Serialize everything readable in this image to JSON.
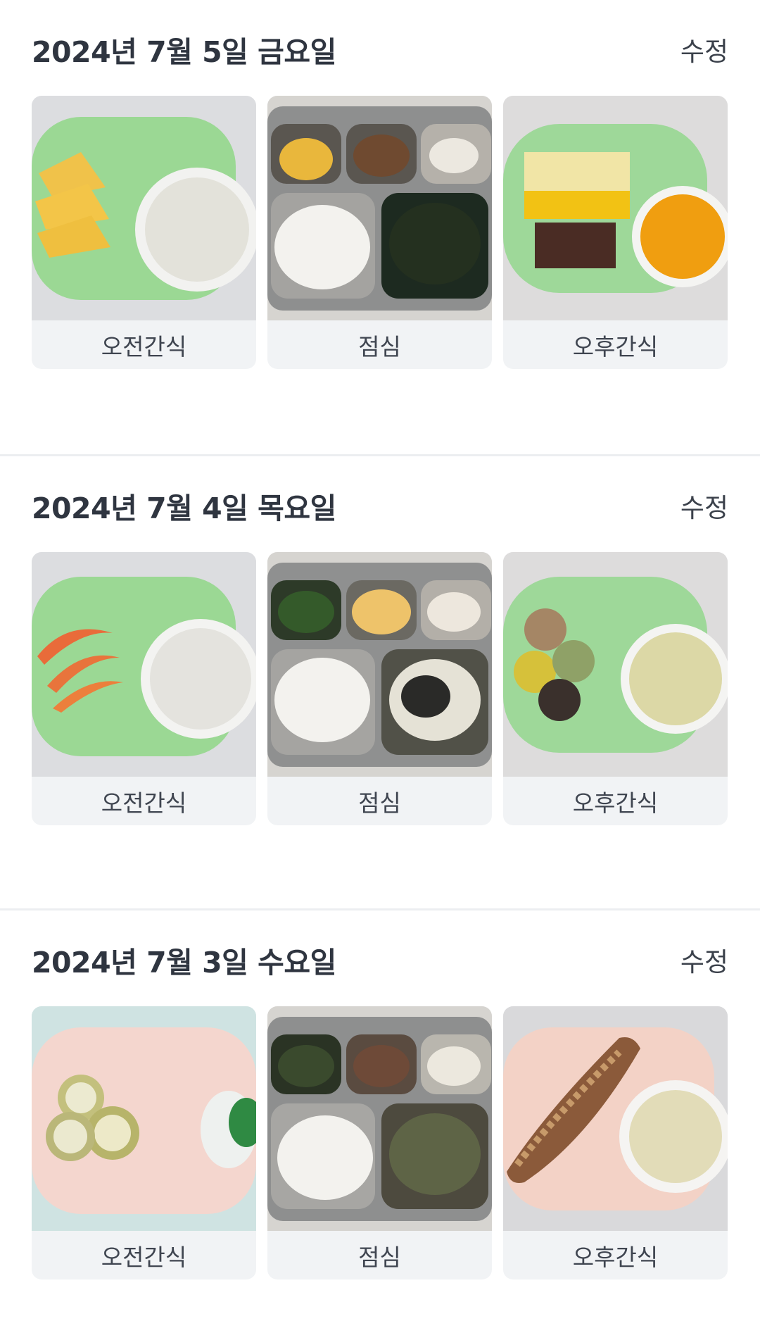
{
  "days": [
    {
      "date": "2024년 7월 5일 금요일",
      "edit_label": "수정",
      "meals": [
        {
          "label": "오전간식",
          "photo": "pineapple-milk-photo"
        },
        {
          "label": "점심",
          "photo": "rice-seaweed-tray-photo"
        },
        {
          "label": "오후간식",
          "photo": "cake-juice-photo"
        }
      ]
    },
    {
      "date": "2024년 7월 4일 목요일",
      "edit_label": "수정",
      "meals": [
        {
          "label": "오전간식",
          "photo": "peach-milk-photo"
        },
        {
          "label": "점심",
          "photo": "rice-egg-tray-photo"
        },
        {
          "label": "오후간식",
          "photo": "ricecake-tea-photo"
        }
      ]
    },
    {
      "date": "2024년 7월 3일 수요일",
      "edit_label": "수정",
      "meals": [
        {
          "label": "오전간식",
          "photo": "banana-yogurt-photo"
        },
        {
          "label": "점심",
          "photo": "rice-soup-tray-photo"
        },
        {
          "label": "오후간식",
          "photo": "corn-tea-photo"
        }
      ]
    }
  ]
}
